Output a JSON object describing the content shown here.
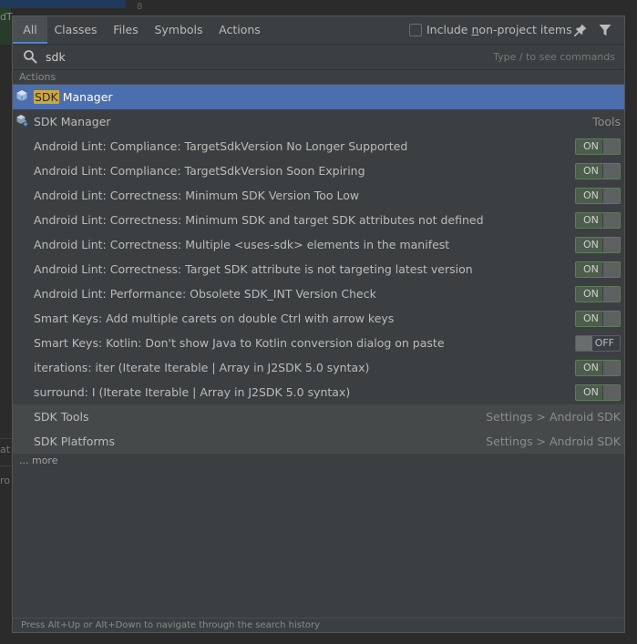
{
  "backdrop": {
    "line_number": "8",
    "side_text_1": "dT",
    "side_text_2": "at",
    "side_text_3": "ro"
  },
  "tabs": [
    {
      "label": "All",
      "active": true
    },
    {
      "label": "Classes",
      "active": false
    },
    {
      "label": "Files",
      "active": false
    },
    {
      "label": "Symbols",
      "active": false
    },
    {
      "label": "Actions",
      "active": false
    }
  ],
  "include_option": {
    "prefix": "Include ",
    "mnemonic": "n",
    "suffix": "on-project items",
    "checked": false
  },
  "search": {
    "value": "sdk",
    "hint": "Type / to see commands"
  },
  "section_header": "Actions",
  "selected_row": {
    "highlight": "SDK",
    "rest": " Manager"
  },
  "rows": [
    {
      "label": "SDK Manager",
      "right": "Tools"
    },
    {
      "label": "Android Lint: Compliance: TargetSdkVersion No Longer Supported",
      "toggle": "ON"
    },
    {
      "label": "Android Lint: Compliance: TargetSdkVersion Soon Expiring",
      "toggle": "ON"
    },
    {
      "label": "Android Lint: Correctness: Minimum SDK Version Too Low",
      "toggle": "ON"
    },
    {
      "label": "Android Lint: Correctness: Minimum SDK and target SDK attributes not defined",
      "toggle": "ON"
    },
    {
      "label": "Android Lint: Correctness: Multiple <uses-sdk> elements in the manifest",
      "toggle": "ON"
    },
    {
      "label": "Android Lint: Correctness: Target SDK attribute is not targeting latest version",
      "toggle": "ON"
    },
    {
      "label": "Android Lint: Performance: Obsolete SDK_INT Version Check",
      "toggle": "ON"
    },
    {
      "label": "Smart Keys: Add multiple carets on double Ctrl with arrow keys",
      "toggle": "ON"
    },
    {
      "label": "Smart Keys: Kotlin: Don't show Java to Kotlin conversion dialog on paste",
      "toggle": "OFF"
    },
    {
      "label": "iterations: iter (Iterate Iterable | Array in J2SDK 5.0 syntax)",
      "toggle": "ON"
    },
    {
      "label": "surround: I (Iterate Iterable | Array in J2SDK 5.0 syntax)",
      "toggle": "ON"
    }
  ],
  "settings_rows": [
    {
      "label": "SDK Tools",
      "right": "Settings > Android SDK"
    },
    {
      "label": "SDK Platforms",
      "right": "Settings > Android SDK"
    }
  ],
  "more_label": "... more",
  "status_text": "Press Alt+Up or Alt+Down to navigate through the search history",
  "colors": {
    "selection": "#4b6eaf",
    "match_highlight": "#cfa83a",
    "toggle_on": "#4c5d4b",
    "popup_bg": "#3c3f41"
  }
}
